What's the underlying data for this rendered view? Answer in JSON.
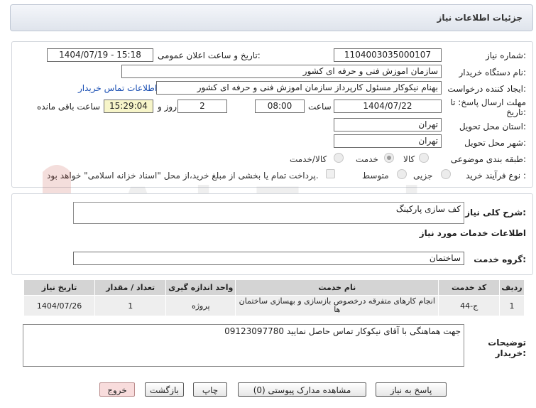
{
  "header": {
    "title": "جزئیات اطلاعات نیاز"
  },
  "form": {
    "need_number_label": "شماره نیاز:",
    "need_number": "1104003035000107",
    "announce_label": "تاریخ و ساعت اعلان عمومی:",
    "announce_value": "1404/07/19 - 15:18",
    "buyer_org_label": "نام دستگاه خریدار:",
    "buyer_org": "سازمان اموزش فنی و حرفه ای کشور",
    "creator_label": "ایجاد کننده درخواست:",
    "creator": "بهنام نیکوکار مسئول کارپرداز سازمان اموزش فنی و حرفه ای کشور",
    "contact_link": "اطلاعات تماس خریدار",
    "deadline_label_1": "مهلت ارسال پاسخ: تا",
    "deadline_label_2": "تاریخ:",
    "deadline_date": "1404/07/22",
    "time_label": "ساعت",
    "deadline_time": "08:00",
    "days_value": "2",
    "days_label": "روز و",
    "time_left": "15:29:04",
    "time_left_label": "ساعت باقی مانده",
    "province_label": "استان محل تحویل:",
    "province": "تهران",
    "city_label": "شهر محل تحویل:",
    "city": "تهران",
    "category_label": "طبقه بندی موضوعی:",
    "category_options": [
      "کالا",
      "خدمت",
      "کالا/خدمت"
    ],
    "category_selected": "خدمت",
    "process_label": "نوع فرآیند خرید :",
    "process_options": [
      "جزیی",
      "متوسط"
    ],
    "payment_note": "پرداخت تمام یا بخشی از مبلغ خرید،از محل \"اسناد خزانه اسلامی\" خواهد بود."
  },
  "description": {
    "label": "شرح کلی نیاز:",
    "value": "کف سازی پارکینگ"
  },
  "services": {
    "section_title": "اطلاعات خدمات مورد نیاز",
    "group_label": "گروه خدمت:",
    "group_value": "ساختمان",
    "columns": [
      "ردیف",
      "کد خدمت",
      "نام خدمت",
      "واحد اندازه گیری",
      "تعداد / مقدار",
      "تاریخ نیاز"
    ],
    "rows": [
      {
        "row": "1",
        "code": "ج-44",
        "name": "انجام کارهای متفرقه درخصوص بازسازی و بهسازی ساختمان ها",
        "unit": "پروژه",
        "qty": "1",
        "date": "1404/07/26"
      }
    ]
  },
  "buyer_notes": {
    "label_1": "توضیحات",
    "label_2": "خریدار:",
    "value": "جهت هماهنگی با آقای نیکوکار تماس حاصل نمایید 09123097780"
  },
  "buttons": {
    "reply": "پاسخ به نیاز",
    "view_docs": "مشاهده مدارک پیوستی (0)",
    "print": "چاپ",
    "back": "بازگشت",
    "exit": "خروج"
  },
  "watermark": {
    "text": "AriaTender.net"
  },
  "colors": {
    "link": "#1a4fb3",
    "time_left_bg": "#f7f5c9",
    "exit_bg": "#f8dcdc"
  }
}
